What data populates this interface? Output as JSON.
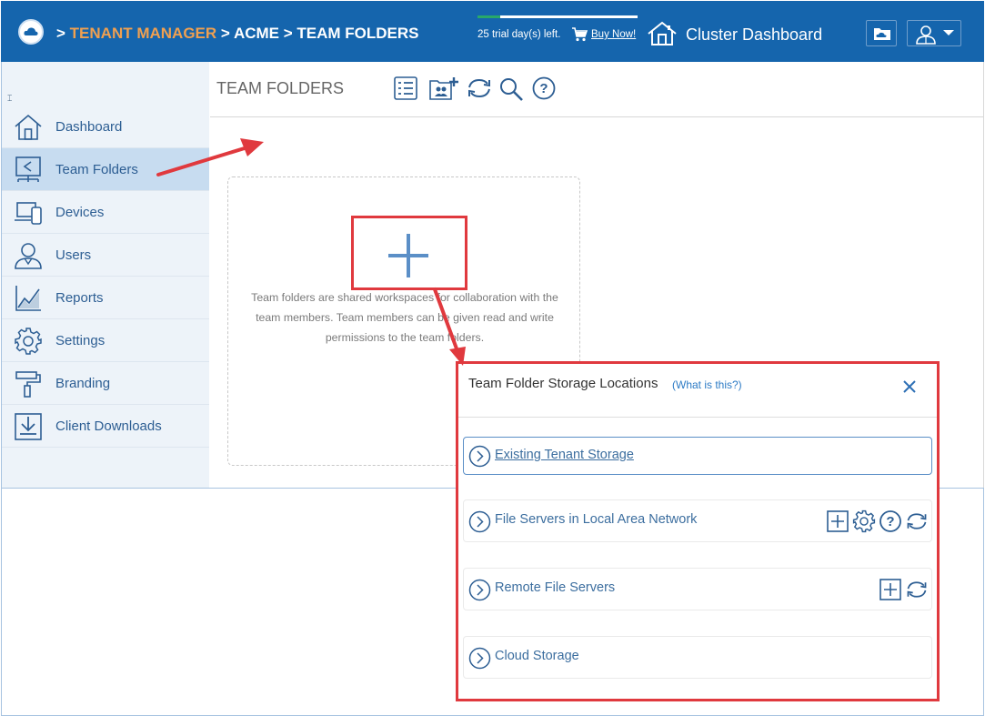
{
  "header": {
    "breadcrumb_prefix": ">",
    "breadcrumb_tenant_manager": "TENANT MANAGER",
    "breadcrumb_sep1": ">",
    "breadcrumb_acme": "ACME",
    "breadcrumb_sep2": ">",
    "breadcrumb_team_folders": "TEAM FOLDERS",
    "trial_text": "25 trial day(s) left.",
    "trial_progress": 0.14,
    "buy_now": "Buy Now!",
    "cluster_dashboard": "Cluster Dashboard"
  },
  "sidebar": {
    "collapse_glyph": "⌶",
    "items": [
      {
        "label": "Dashboard",
        "icon": "home-icon"
      },
      {
        "label": "Team Folders",
        "icon": "shared-folder-icon",
        "active": true
      },
      {
        "label": "Devices",
        "icon": "devices-icon"
      },
      {
        "label": "Users",
        "icon": "user-icon"
      },
      {
        "label": "Reports",
        "icon": "chart-icon"
      },
      {
        "label": "Settings",
        "icon": "gear-icon"
      },
      {
        "label": "Branding",
        "icon": "paint-roller-icon"
      },
      {
        "label": "Client Downloads",
        "icon": "download-icon"
      }
    ]
  },
  "main": {
    "title": "TEAM FOLDERS",
    "toolbar_icons": [
      "list-icon",
      "add-team-folder-icon",
      "refresh-icon",
      "search-icon",
      "help-icon"
    ],
    "card_description": "Team folders are shared workspaces for collaboration with the team members. Team members can be given read and write permissions to the team folders."
  },
  "modal": {
    "title": "Team Folder Storage Locations",
    "what_is_this": "(What is this?)",
    "options": [
      {
        "label": "Existing Tenant Storage",
        "selected": true
      },
      {
        "label": "File Servers in Local Area Network",
        "icons": [
          "add-icon",
          "gear-icon",
          "help-icon",
          "refresh-icon"
        ]
      },
      {
        "label": "Remote File Servers",
        "icons": [
          "add-icon",
          "refresh-icon"
        ]
      },
      {
        "label": "Cloud Storage"
      }
    ]
  },
  "colors": {
    "header_bg": "#1565ad",
    "accent_orange": "#f0a050",
    "highlight_red": "#e0393e",
    "link_blue": "#2d7bc5"
  }
}
